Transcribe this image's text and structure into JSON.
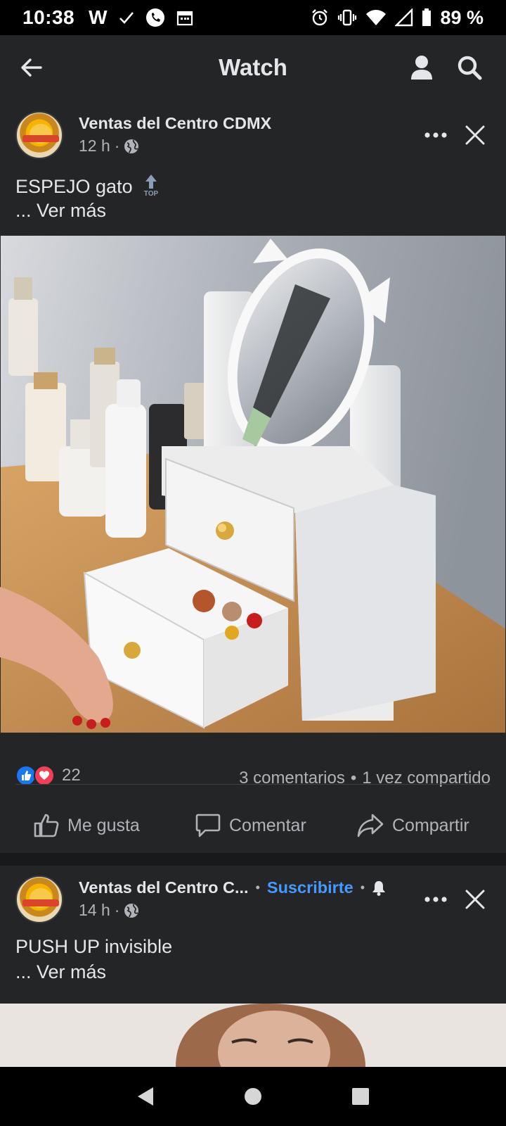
{
  "status_bar": {
    "time": "10:38",
    "battery": "89 %",
    "left_icons": [
      "w-icon",
      "check-icon",
      "phone-icon",
      "calendar-icon"
    ],
    "right_icons": [
      "alarm-icon",
      "vibrate-icon",
      "wifi-icon",
      "signal-icon",
      "battery-icon"
    ]
  },
  "app_bar": {
    "title": "Watch"
  },
  "post1": {
    "page_name": "Ventas del Centro CDMX",
    "time": "12 h",
    "dot": "·",
    "text": "ESPEJO gato",
    "see_more": "... Ver más",
    "reaction_count": "22",
    "comments": "3 comentarios",
    "stats_sep": "•",
    "shares": "1 vez compartido",
    "actions": {
      "like": "Me gusta",
      "comment": "Comentar",
      "share": "Compartir"
    }
  },
  "post2": {
    "page_name": "Ventas del Centro C...",
    "sep1": "•",
    "subscribe": "Suscribirte",
    "sep2": "•",
    "time": "14 h",
    "dot": "·",
    "text": "PUSH UP invisible",
    "see_more": "... Ver más"
  },
  "colors": {
    "background": "#18191a",
    "card": "#242526",
    "accent": "#4599ff",
    "like": "#1877f2",
    "love": "#f33e58"
  }
}
